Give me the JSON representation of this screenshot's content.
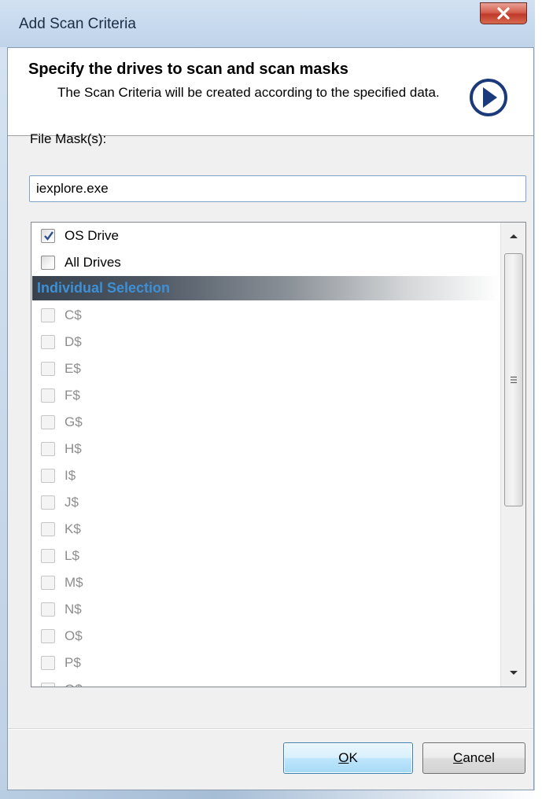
{
  "window": {
    "title": "Add Scan Criteria"
  },
  "header": {
    "title": "Specify the drives to scan and scan masks",
    "subtitle": "The Scan Criteria will be created according to the specified data."
  },
  "mask": {
    "label": "File Mask(s):",
    "value": "iexplore.exe"
  },
  "drives": {
    "top_options": [
      {
        "label": "OS Drive",
        "checked": true
      },
      {
        "label": "All Drives",
        "checked": false
      }
    ],
    "section_label": "Individual Selection",
    "individual": [
      "C$",
      "D$",
      "E$",
      "F$",
      "G$",
      "H$",
      "I$",
      "J$",
      "K$",
      "L$",
      "M$",
      "N$",
      "O$",
      "P$",
      "Q$"
    ]
  },
  "buttons": {
    "ok_label": "OK",
    "ok_underline": "O",
    "ok_rest": "K",
    "cancel_label": "Cancel",
    "cancel_underline": "C",
    "cancel_rest": "ancel"
  },
  "colors": {
    "section_label": "#3d8fd6",
    "next_icon": "#1a3a7c"
  },
  "icons": {
    "close": "close-x-icon",
    "next": "next-arrow-icon",
    "scroll_up": "scroll-up-arrow-icon",
    "scroll_down": "scroll-down-arrow-icon",
    "grip": "scroll-grip-icon",
    "check": "checkmark-icon"
  }
}
